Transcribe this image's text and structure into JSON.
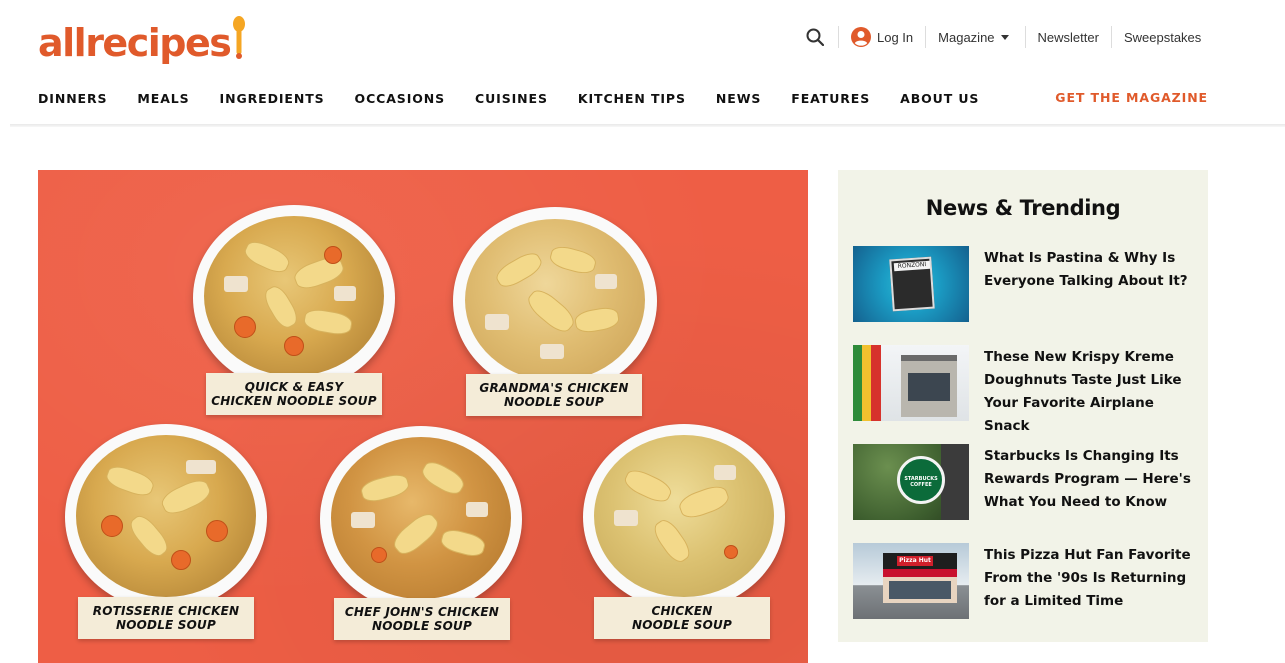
{
  "brand": {
    "logo_text": "allrecipes",
    "accent_color": "#e05a2b"
  },
  "utility": {
    "search_icon": "search-icon",
    "login_label": "Log In",
    "magazine_label": "Magazine",
    "newsletter_label": "Newsletter",
    "sweepstakes_label": "Sweepstakes"
  },
  "nav": {
    "items": [
      "DINNERS",
      "MEALS",
      "INGREDIENTS",
      "OCCASIONS",
      "CUISINES",
      "KITCHEN TIPS",
      "NEWS",
      "FEATURES",
      "ABOUT US"
    ],
    "cta": "GET THE MAGAZINE"
  },
  "hero": {
    "background_color": "#ee5e45",
    "labels": [
      [
        "QUICK & EASY",
        "CHICKEN NOODLE SOUP"
      ],
      [
        "GRANDMA'S CHICKEN",
        "NOODLE SOUP"
      ],
      [
        "ROTISSERIE CHICKEN",
        "NOODLE SOUP"
      ],
      [
        "CHEF JOHN'S CHICKEN",
        "NOODLE SOUP"
      ],
      [
        "CHICKEN",
        "NOODLE SOUP"
      ]
    ]
  },
  "sidebar": {
    "title": "News & Trending",
    "background_color": "#f2f3e8",
    "items": [
      {
        "title": "What Is Pastina & Why Is Everyone Talking About It?",
        "thumb_brand": "RONZONI"
      },
      {
        "title": "These New Krispy Kreme Doughnuts Taste Just Like Your Favorite Airplane Snack"
      },
      {
        "title": "Starbucks Is Changing Its Rewards Program — Here's What You Need to Know",
        "thumb_brand": "STARBUCKS COFFEE"
      },
      {
        "title": "This Pizza Hut Fan Favorite From the '90s Is Returning for a Limited Time",
        "thumb_brand": "Pizza Hut"
      }
    ]
  }
}
